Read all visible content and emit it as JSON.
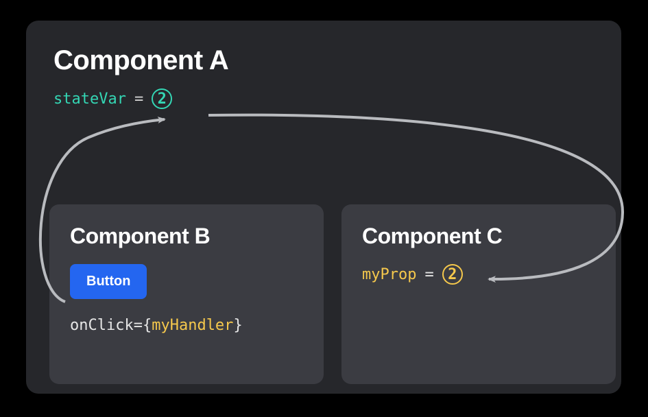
{
  "componentA": {
    "title": "Component A",
    "stateVarName": "stateVar",
    "equals": "=",
    "stateValue": "2"
  },
  "componentB": {
    "title": "Component B",
    "buttonLabel": "Button",
    "onClickPrefix": "onClick={",
    "onClickHandler": "myHandler",
    "onClickSuffix": "}"
  },
  "componentC": {
    "title": "Component C",
    "propName": "myProp",
    "equals": "=",
    "propValue": "2"
  },
  "colors": {
    "teal": "#34d6b4",
    "gold": "#f5c84c",
    "blue": "#2466f0",
    "panelA": "#26272B",
    "panelBC": "#3B3C42",
    "arrow": "#b9bbbf"
  }
}
